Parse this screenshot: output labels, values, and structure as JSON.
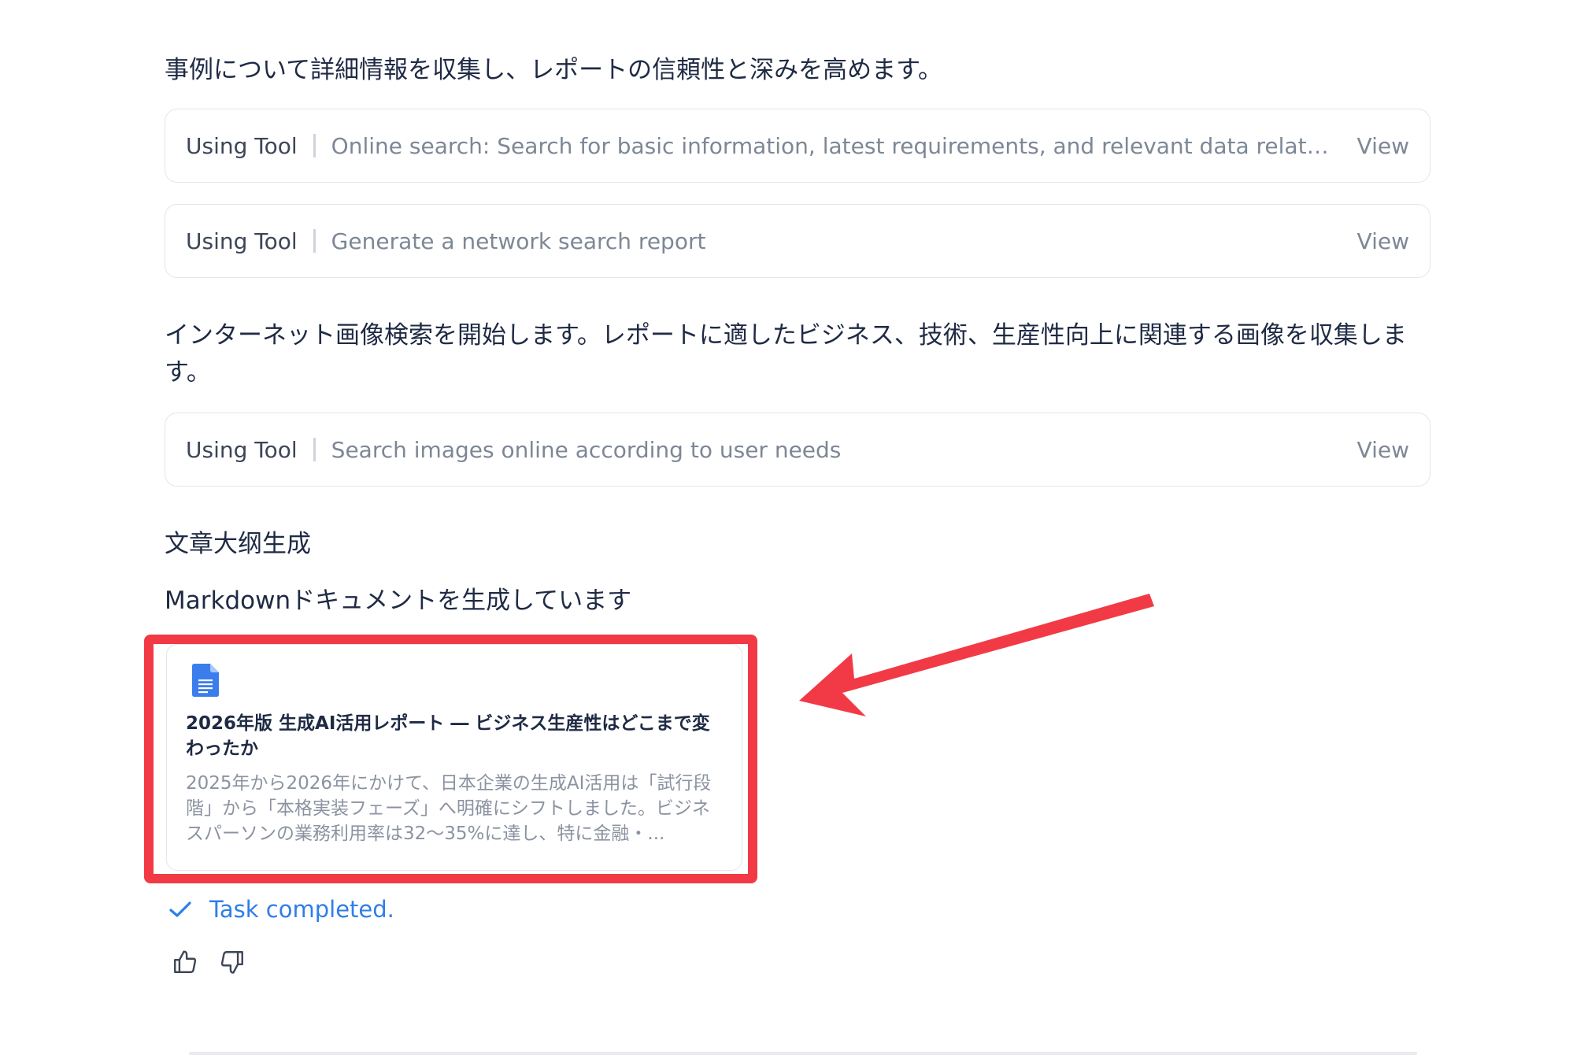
{
  "messages": {
    "intro": "事例について詳細情報を収集し、レポートの信頼性と深みを高めます。",
    "image_search": "インターネット画像検索を開始します。レポートに適したビジネス、技術、生産性向上に関連する画像を収集します。",
    "outline": "文章大纲生成",
    "markdown": "Markdownドキュメントを生成しています"
  },
  "tool_calls": [
    {
      "label": "Using Tool",
      "description": "Online search: Search for basic information, latest requirements, and relevant data related to th...",
      "view": "View"
    },
    {
      "label": "Using Tool",
      "description": "Generate a network search report",
      "view": "View"
    },
    {
      "label": "Using Tool",
      "description": "Search images online according to user needs",
      "view": "View"
    }
  ],
  "document": {
    "icon": "document-icon",
    "title": "2026年版 生成AI活用レポート ― ビジネス生産性はどこまで変わったか",
    "summary": "2025年から2026年にかけて、日本企業の生成AI活用は「試行段階」から「本格実装フェーズ」へ明確にシフトしました。ビジネスパーソンの業務利用率は32〜35%に達し、特に金融・..."
  },
  "status": {
    "icon": "check-icon",
    "text": "Task completed."
  },
  "feedback": {
    "like_icon": "thumbs-up-icon",
    "dislike_icon": "thumbs-down-icon"
  },
  "colors": {
    "highlight": "#f23a46",
    "accent": "#2f7ee8",
    "doc_icon": "#3b7ded"
  }
}
